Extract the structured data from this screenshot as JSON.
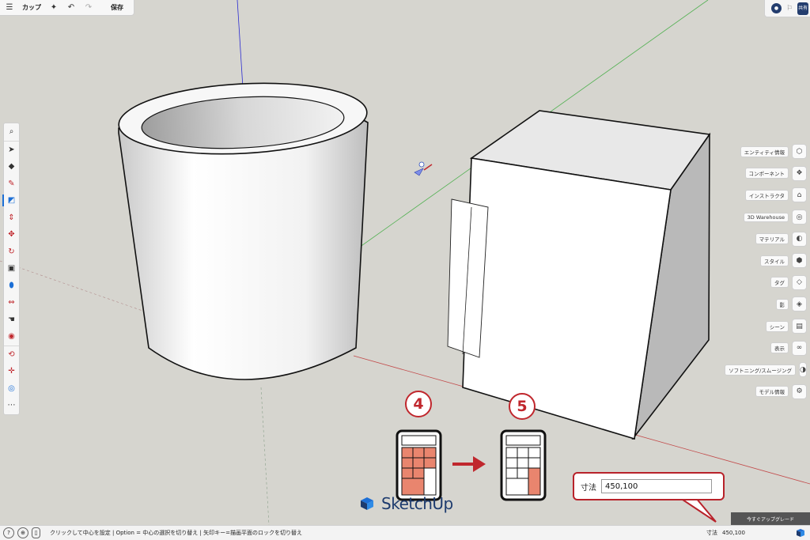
{
  "topbar": {
    "model_title": "カップ",
    "save_label": "保存"
  },
  "topright": {
    "share_label": "共有"
  },
  "tray": {
    "items": [
      {
        "label": "エンティティ情報",
        "icon": "entity-info-icon"
      },
      {
        "label": "コンポーネント",
        "icon": "components-icon"
      },
      {
        "label": "インストラクタ",
        "icon": "instructor-icon"
      },
      {
        "label": "3D Warehouse",
        "icon": "warehouse-icon"
      },
      {
        "label": "マテリアル",
        "icon": "materials-icon"
      },
      {
        "label": "スタイル",
        "icon": "styles-icon"
      },
      {
        "label": "タグ",
        "icon": "tags-icon"
      },
      {
        "label": "影",
        "icon": "shadows-icon"
      },
      {
        "label": "シーン",
        "icon": "scenes-icon"
      },
      {
        "label": "表示",
        "icon": "display-icon"
      },
      {
        "label": "ソフトニング/スムージング",
        "icon": "soften-smooth-icon"
      },
      {
        "label": "モデル情報",
        "icon": "model-info-icon"
      }
    ]
  },
  "annotation": {
    "step_a": "4",
    "step_b": "5"
  },
  "callout": {
    "label": "寸法",
    "value": "450,100"
  },
  "upgrade_label": "今すぐアップグレード",
  "logo_text": "SketchUp",
  "status": {
    "message": "クリックして中心を設定 | Option = 中心の選択を切り替え | 矢印キー=描画平面のロックを切り替え",
    "measure_label": "寸法",
    "measure_value": "450,100"
  },
  "colors": {
    "accent_red": "#c0272d",
    "brand_navy": "#1d3b6e",
    "keypad_fill": "#e9856e"
  }
}
